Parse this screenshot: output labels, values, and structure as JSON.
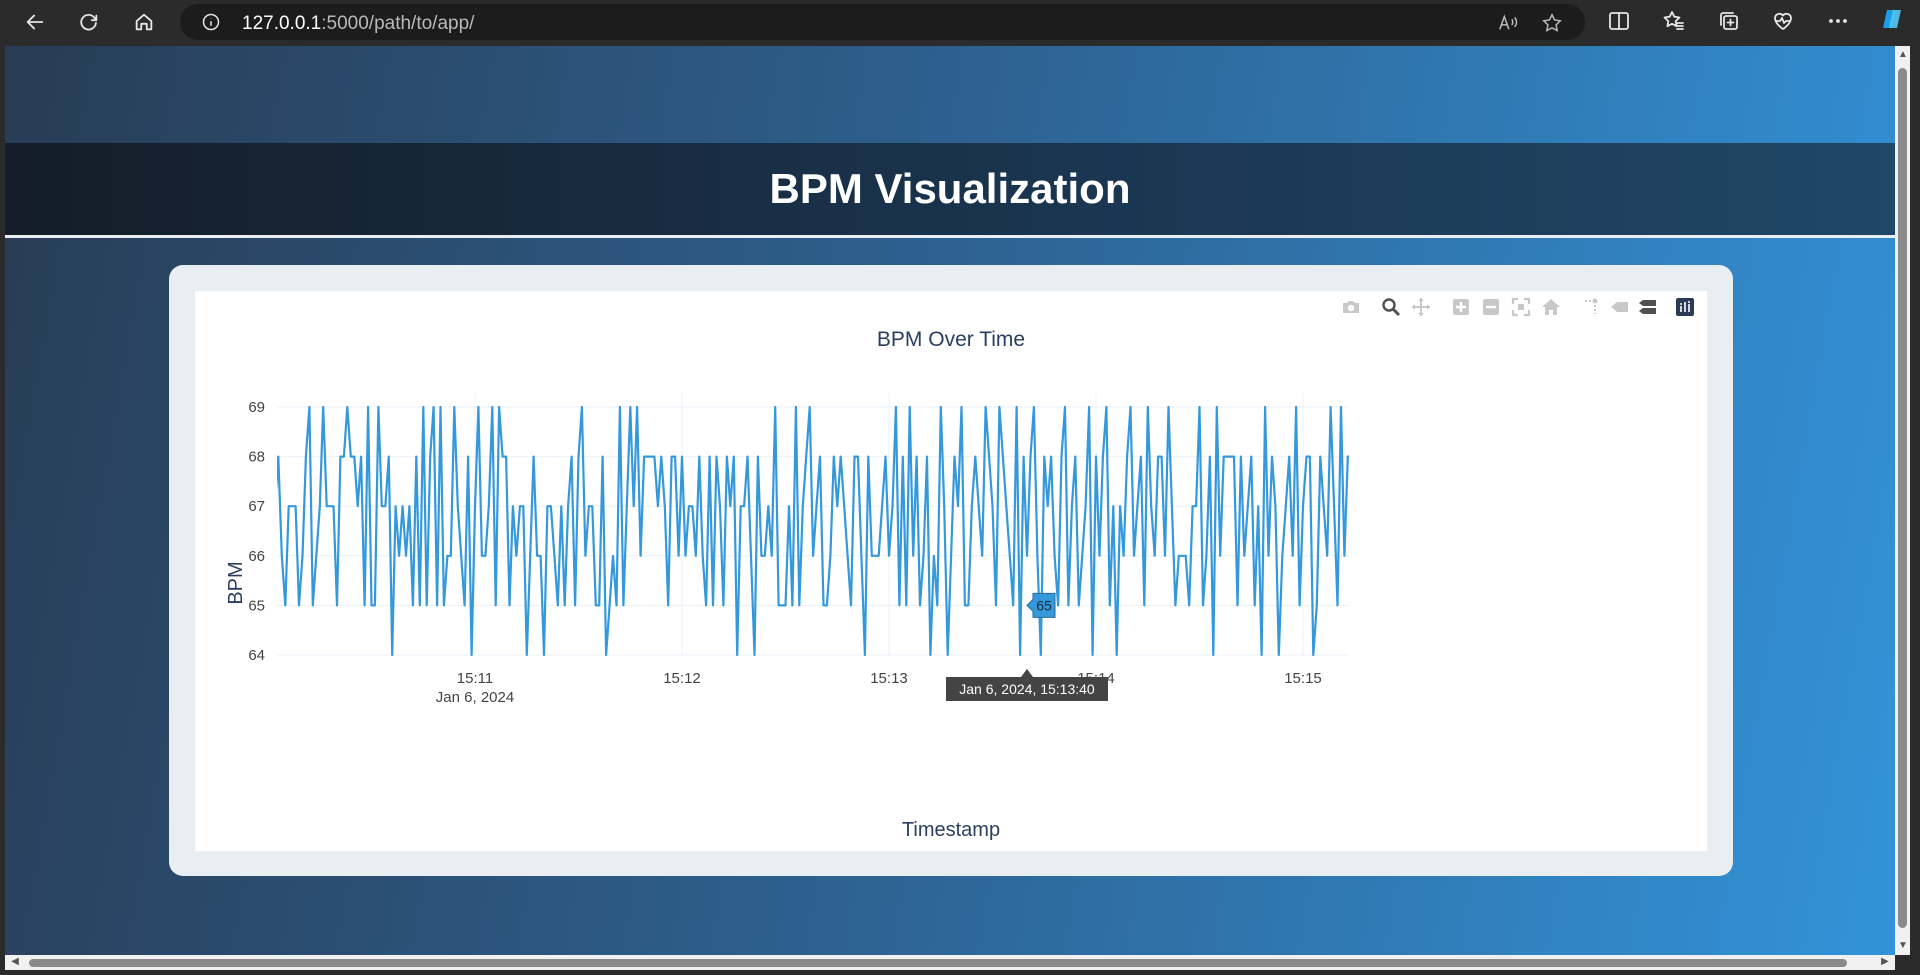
{
  "browser": {
    "url_host": "127.0.0.1",
    "url_rest": ":5000/path/to/app/"
  },
  "page": {
    "title": "BPM Visualization"
  },
  "hover": {
    "x_label": "Jan 6, 2024, 15:13:40",
    "y_label": "65",
    "x": "2024-01-06 15:13:40",
    "y": 65
  },
  "chart_data": {
    "type": "line",
    "title": "BPM Over Time",
    "xlabel": "Timestamp",
    "ylabel": "BPM",
    "x_start": "2024-01-06 15:10:00",
    "x_step_seconds": 1,
    "x_ticks": [
      {
        "time": "15:11",
        "sub": "Jan 6, 2024"
      },
      {
        "time": "15:12",
        "sub": ""
      },
      {
        "time": "15:13",
        "sub": ""
      },
      {
        "time": "15:14",
        "sub": ""
      },
      {
        "time": "15:15",
        "sub": ""
      }
    ],
    "y_ticks": [
      "64",
      "65",
      "66",
      "67",
      "68",
      "69"
    ],
    "ylim": [
      64,
      69
    ],
    "color": "#3498db",
    "grid": true,
    "series": [
      {
        "values": [
          67,
          66,
          67,
          68,
          66,
          65,
          67,
          67,
          67,
          65,
          66,
          68,
          69,
          65,
          66,
          67,
          69,
          67,
          67,
          67,
          65,
          68,
          68,
          69,
          68,
          68,
          67,
          68,
          65,
          69,
          65,
          65,
          69,
          67,
          67,
          68,
          64,
          67,
          66,
          67,
          66,
          67,
          65,
          68,
          65,
          69,
          65,
          68,
          69,
          65,
          69,
          65,
          66,
          66,
          69,
          67,
          66,
          65,
          68,
          64,
          67,
          69,
          66,
          66,
          67,
          69,
          65,
          69,
          68,
          68,
          65,
          67,
          66,
          67,
          67,
          64,
          66,
          68,
          66,
          66,
          64,
          67,
          67,
          66,
          65,
          67,
          65,
          67,
          68,
          65,
          68,
          69,
          66,
          67,
          67,
          65,
          65,
          68,
          64,
          65,
          66,
          65,
          69,
          65,
          67,
          69,
          67,
          69,
          66,
          68,
          68,
          68,
          68,
          67,
          68,
          67,
          65,
          68,
          68,
          66,
          68,
          66,
          67,
          67,
          66,
          68,
          66,
          65,
          68,
          65,
          68,
          67,
          65,
          68,
          67,
          68,
          64,
          67,
          67,
          68,
          66,
          64,
          68,
          66,
          66,
          67,
          66,
          69,
          65,
          65,
          65,
          67,
          65,
          69,
          65,
          67,
          68,
          69,
          66,
          67,
          68,
          65,
          65,
          66,
          68,
          67,
          68,
          67,
          66,
          65,
          68,
          68,
          66,
          64,
          68,
          66,
          66,
          66,
          67,
          68,
          66,
          67,
          69,
          65,
          68,
          65,
          69,
          66,
          68,
          65,
          66,
          68,
          64,
          66,
          65,
          69,
          67,
          64,
          66,
          68,
          67,
          69,
          65,
          65,
          67,
          68,
          67,
          66,
          69,
          68,
          67,
          65,
          69,
          68,
          67,
          66,
          65,
          69,
          64,
          68,
          66,
          68,
          69,
          66,
          64,
          68,
          67,
          68,
          66,
          65,
          68,
          69,
          65,
          67,
          68,
          65,
          66,
          67,
          69,
          64,
          68,
          66,
          68,
          69,
          65,
          67,
          64,
          67,
          66,
          68,
          69,
          66,
          67,
          68,
          65,
          69,
          67,
          66,
          68,
          68,
          66,
          69,
          67,
          65,
          66,
          66,
          66,
          65,
          67,
          67,
          69,
          65,
          66,
          68,
          64,
          69,
          66,
          68,
          68,
          68,
          68,
          65,
          68,
          66,
          67,
          68,
          65,
          67,
          64,
          69,
          66,
          68,
          67,
          64,
          66,
          67,
          68,
          66,
          69,
          65,
          67,
          68,
          68,
          64,
          65,
          68,
          67,
          66,
          69,
          67,
          65,
          69,
          66,
          68,
          68,
          65,
          67,
          66,
          68,
          68,
          64,
          69,
          68
        ]
      }
    ]
  }
}
